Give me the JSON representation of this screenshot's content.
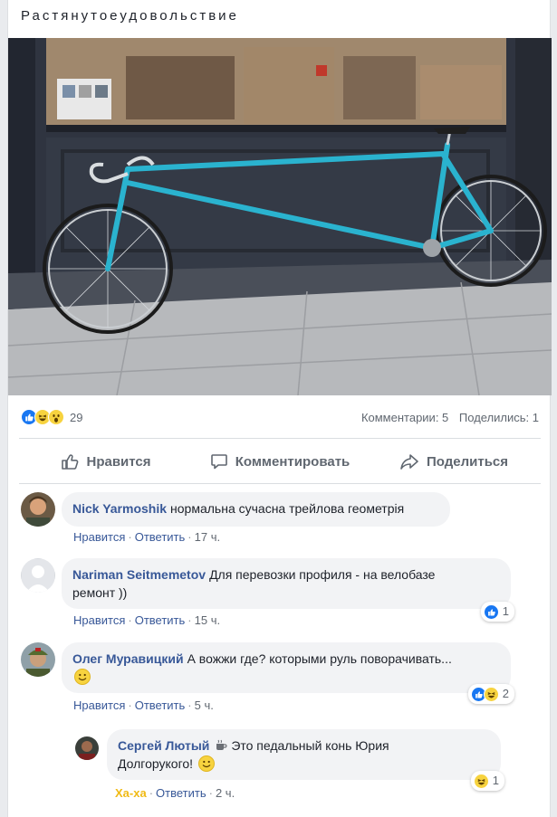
{
  "post": {
    "text": "Растянутоеудовольствие"
  },
  "summary": {
    "reaction_count": "29",
    "comments": "Комментарии: 5",
    "shares": "Поделились: 1"
  },
  "actions": {
    "like": "Нравится",
    "comment": "Комментировать",
    "share": "Поделиться"
  },
  "comments": [
    {
      "author": "Nick Yarmoshik",
      "text": "нормальна сучасна трейлова геометрія",
      "like": "Нравится",
      "reply": "Ответить",
      "time": "17 ч."
    },
    {
      "author": "Nariman Seitmemetov",
      "text_line1": "Для перевозки профиля - на велобазе",
      "text_line2": "ремонт ))",
      "like": "Нравится",
      "reply": "Ответить",
      "time": "15 ч.",
      "reactions": "1"
    },
    {
      "author": "Олег Муравицкий",
      "text": "А вожжи где? которыми руль поворачивать...",
      "like": "Нравится",
      "reply": "Ответить",
      "time": "5 ч.",
      "reactions": "2"
    },
    {
      "author": "Сергей Лютый",
      "text_line1": "Это педальный конь Юрия",
      "text_line2": "Долгорукого!",
      "reaction_label": "Ха-ха",
      "reply": "Ответить",
      "time": "2 ч.",
      "reactions": "1"
    }
  ],
  "icons": {
    "like": "like-icon",
    "haha": "haha-icon",
    "wow": "wow-icon",
    "comment": "comment-icon",
    "share": "share-icon",
    "coffee": "coffee-icon",
    "smile": "smile-emoji"
  },
  "colors": {
    "link": "#385898",
    "like_blue": "#1877f2",
    "haha_yellow": "#f7d33f",
    "bike_cyan": "#2ab3cf"
  }
}
